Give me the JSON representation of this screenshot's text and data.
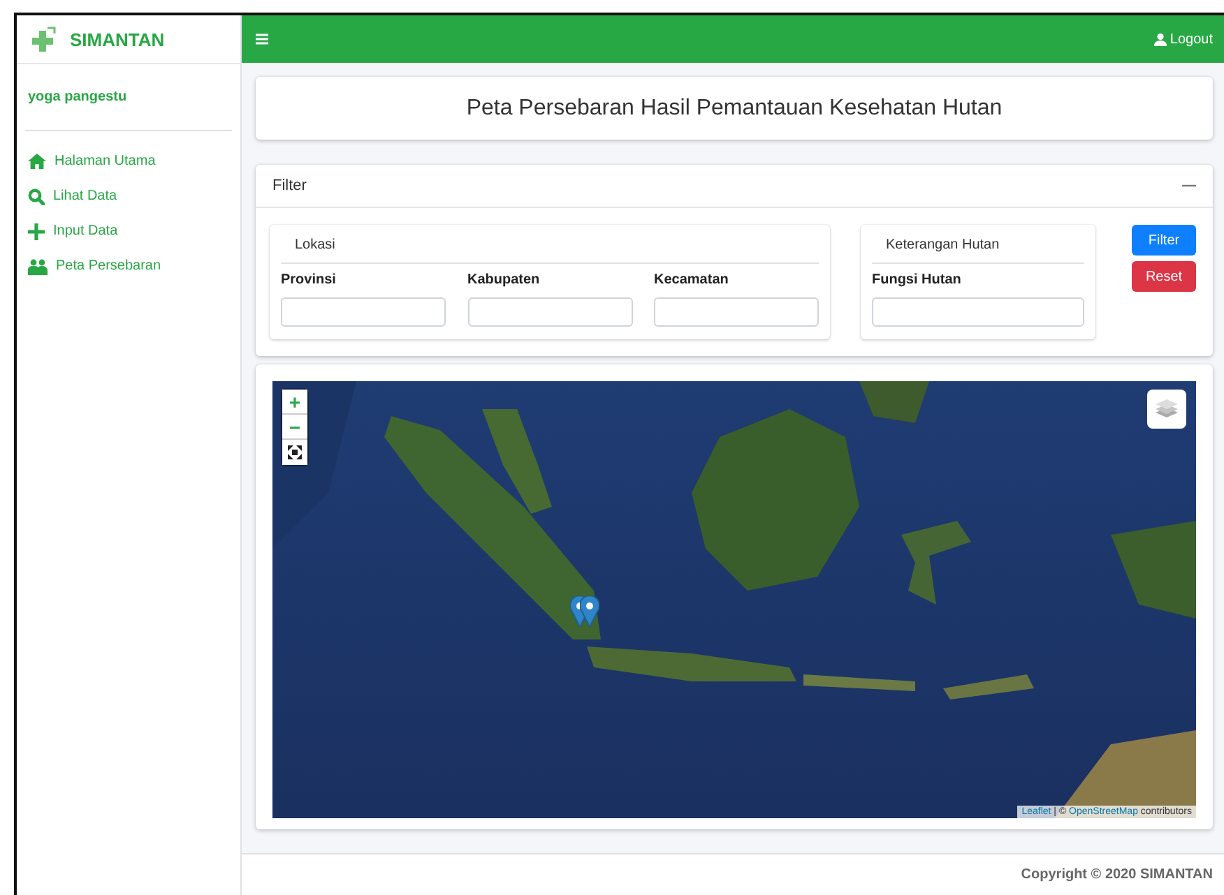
{
  "brand": {
    "name": "SIMANTAN"
  },
  "user": {
    "name": "yoga pangestu"
  },
  "menu": [
    {
      "label": "Halaman Utama"
    },
    {
      "label": "Lihat Data"
    },
    {
      "label": "Input Data"
    },
    {
      "label": "Peta Persebaran"
    }
  ],
  "topbar": {
    "logout": "Logout"
  },
  "page_title": "Peta Persebaran Hasil Pemantauan Kesehatan Hutan",
  "filter": {
    "title": "Filter",
    "groups": [
      {
        "title": "Lokasi",
        "fields": [
          {
            "label": "Provinsi"
          },
          {
            "label": "Kabupaten"
          },
          {
            "label": "Kecamatan"
          }
        ]
      },
      {
        "title": "Keterangan Hutan",
        "fields": [
          {
            "label": "Fungsi Hutan"
          }
        ]
      }
    ],
    "buttons": [
      {
        "label": "Filter",
        "kind": "primary"
      },
      {
        "label": "Reset",
        "kind": "danger"
      }
    ]
  },
  "map": {
    "zoom_in": "+",
    "zoom_out": "−",
    "attribution": [
      {
        "text": "Leaflet",
        "kind": "link"
      },
      {
        "text": " | © ",
        "kind": "text"
      },
      {
        "text": "OpenStreetMap",
        "kind": "link"
      },
      {
        "text": " contributors",
        "kind": "text"
      }
    ]
  },
  "footer": "Copyright © 2020 SIMANTAN"
}
